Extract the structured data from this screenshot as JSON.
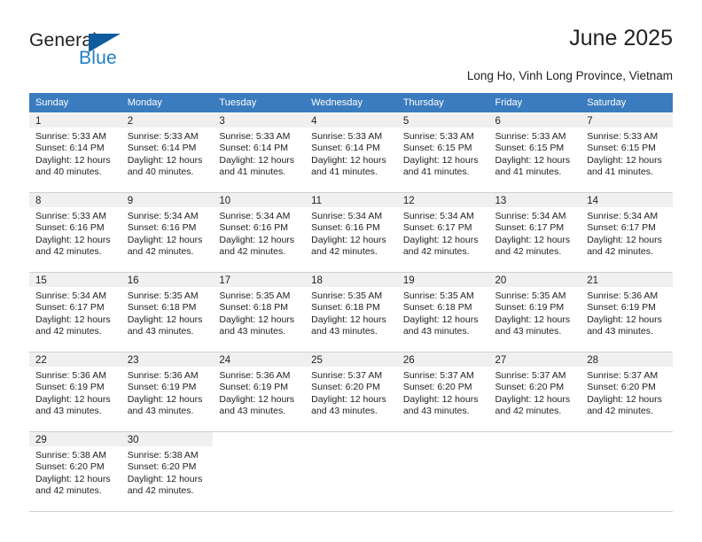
{
  "logo": {
    "text_top": "General",
    "text_bottom": "Blue",
    "triangle_color": "#0d5c9e",
    "blue_color": "#1f7ec2"
  },
  "header": {
    "title": "June 2025",
    "subtitle": "Long Ho, Vinh Long Province, Vietnam"
  },
  "theme": {
    "header_bg": "#3a7cbe",
    "header_text": "#ffffff",
    "daynum_bg": "#f0f0f0",
    "grid_line": "#cfcfcf",
    "body_text": "#222222"
  },
  "calendar": {
    "weekday_headers": [
      "Sunday",
      "Monday",
      "Tuesday",
      "Wednesday",
      "Thursday",
      "Friday",
      "Saturday"
    ],
    "weeks": [
      [
        {
          "day": "1",
          "sunrise": "Sunrise: 5:33 AM",
          "sunset": "Sunset: 6:14 PM",
          "daylight_line1": "Daylight: 12 hours",
          "daylight_line2": "and 40 minutes."
        },
        {
          "day": "2",
          "sunrise": "Sunrise: 5:33 AM",
          "sunset": "Sunset: 6:14 PM",
          "daylight_line1": "Daylight: 12 hours",
          "daylight_line2": "and 40 minutes."
        },
        {
          "day": "3",
          "sunrise": "Sunrise: 5:33 AM",
          "sunset": "Sunset: 6:14 PM",
          "daylight_line1": "Daylight: 12 hours",
          "daylight_line2": "and 41 minutes."
        },
        {
          "day": "4",
          "sunrise": "Sunrise: 5:33 AM",
          "sunset": "Sunset: 6:14 PM",
          "daylight_line1": "Daylight: 12 hours",
          "daylight_line2": "and 41 minutes."
        },
        {
          "day": "5",
          "sunrise": "Sunrise: 5:33 AM",
          "sunset": "Sunset: 6:15 PM",
          "daylight_line1": "Daylight: 12 hours",
          "daylight_line2": "and 41 minutes."
        },
        {
          "day": "6",
          "sunrise": "Sunrise: 5:33 AM",
          "sunset": "Sunset: 6:15 PM",
          "daylight_line1": "Daylight: 12 hours",
          "daylight_line2": "and 41 minutes."
        },
        {
          "day": "7",
          "sunrise": "Sunrise: 5:33 AM",
          "sunset": "Sunset: 6:15 PM",
          "daylight_line1": "Daylight: 12 hours",
          "daylight_line2": "and 41 minutes."
        }
      ],
      [
        {
          "day": "8",
          "sunrise": "Sunrise: 5:33 AM",
          "sunset": "Sunset: 6:16 PM",
          "daylight_line1": "Daylight: 12 hours",
          "daylight_line2": "and 42 minutes."
        },
        {
          "day": "9",
          "sunrise": "Sunrise: 5:34 AM",
          "sunset": "Sunset: 6:16 PM",
          "daylight_line1": "Daylight: 12 hours",
          "daylight_line2": "and 42 minutes."
        },
        {
          "day": "10",
          "sunrise": "Sunrise: 5:34 AM",
          "sunset": "Sunset: 6:16 PM",
          "daylight_line1": "Daylight: 12 hours",
          "daylight_line2": "and 42 minutes."
        },
        {
          "day": "11",
          "sunrise": "Sunrise: 5:34 AM",
          "sunset": "Sunset: 6:16 PM",
          "daylight_line1": "Daylight: 12 hours",
          "daylight_line2": "and 42 minutes."
        },
        {
          "day": "12",
          "sunrise": "Sunrise: 5:34 AM",
          "sunset": "Sunset: 6:17 PM",
          "daylight_line1": "Daylight: 12 hours",
          "daylight_line2": "and 42 minutes."
        },
        {
          "day": "13",
          "sunrise": "Sunrise: 5:34 AM",
          "sunset": "Sunset: 6:17 PM",
          "daylight_line1": "Daylight: 12 hours",
          "daylight_line2": "and 42 minutes."
        },
        {
          "day": "14",
          "sunrise": "Sunrise: 5:34 AM",
          "sunset": "Sunset: 6:17 PM",
          "daylight_line1": "Daylight: 12 hours",
          "daylight_line2": "and 42 minutes."
        }
      ],
      [
        {
          "day": "15",
          "sunrise": "Sunrise: 5:34 AM",
          "sunset": "Sunset: 6:17 PM",
          "daylight_line1": "Daylight: 12 hours",
          "daylight_line2": "and 42 minutes."
        },
        {
          "day": "16",
          "sunrise": "Sunrise: 5:35 AM",
          "sunset": "Sunset: 6:18 PM",
          "daylight_line1": "Daylight: 12 hours",
          "daylight_line2": "and 43 minutes."
        },
        {
          "day": "17",
          "sunrise": "Sunrise: 5:35 AM",
          "sunset": "Sunset: 6:18 PM",
          "daylight_line1": "Daylight: 12 hours",
          "daylight_line2": "and 43 minutes."
        },
        {
          "day": "18",
          "sunrise": "Sunrise: 5:35 AM",
          "sunset": "Sunset: 6:18 PM",
          "daylight_line1": "Daylight: 12 hours",
          "daylight_line2": "and 43 minutes."
        },
        {
          "day": "19",
          "sunrise": "Sunrise: 5:35 AM",
          "sunset": "Sunset: 6:18 PM",
          "daylight_line1": "Daylight: 12 hours",
          "daylight_line2": "and 43 minutes."
        },
        {
          "day": "20",
          "sunrise": "Sunrise: 5:35 AM",
          "sunset": "Sunset: 6:19 PM",
          "daylight_line1": "Daylight: 12 hours",
          "daylight_line2": "and 43 minutes."
        },
        {
          "day": "21",
          "sunrise": "Sunrise: 5:36 AM",
          "sunset": "Sunset: 6:19 PM",
          "daylight_line1": "Daylight: 12 hours",
          "daylight_line2": "and 43 minutes."
        }
      ],
      [
        {
          "day": "22",
          "sunrise": "Sunrise: 5:36 AM",
          "sunset": "Sunset: 6:19 PM",
          "daylight_line1": "Daylight: 12 hours",
          "daylight_line2": "and 43 minutes."
        },
        {
          "day": "23",
          "sunrise": "Sunrise: 5:36 AM",
          "sunset": "Sunset: 6:19 PM",
          "daylight_line1": "Daylight: 12 hours",
          "daylight_line2": "and 43 minutes."
        },
        {
          "day": "24",
          "sunrise": "Sunrise: 5:36 AM",
          "sunset": "Sunset: 6:19 PM",
          "daylight_line1": "Daylight: 12 hours",
          "daylight_line2": "and 43 minutes."
        },
        {
          "day": "25",
          "sunrise": "Sunrise: 5:37 AM",
          "sunset": "Sunset: 6:20 PM",
          "daylight_line1": "Daylight: 12 hours",
          "daylight_line2": "and 43 minutes."
        },
        {
          "day": "26",
          "sunrise": "Sunrise: 5:37 AM",
          "sunset": "Sunset: 6:20 PM",
          "daylight_line1": "Daylight: 12 hours",
          "daylight_line2": "and 43 minutes."
        },
        {
          "day": "27",
          "sunrise": "Sunrise: 5:37 AM",
          "sunset": "Sunset: 6:20 PM",
          "daylight_line1": "Daylight: 12 hours",
          "daylight_line2": "and 42 minutes."
        },
        {
          "day": "28",
          "sunrise": "Sunrise: 5:37 AM",
          "sunset": "Sunset: 6:20 PM",
          "daylight_line1": "Daylight: 12 hours",
          "daylight_line2": "and 42 minutes."
        }
      ],
      [
        {
          "day": "29",
          "sunrise": "Sunrise: 5:38 AM",
          "sunset": "Sunset: 6:20 PM",
          "daylight_line1": "Daylight: 12 hours",
          "daylight_line2": "and 42 minutes."
        },
        {
          "day": "30",
          "sunrise": "Sunrise: 5:38 AM",
          "sunset": "Sunset: 6:20 PM",
          "daylight_line1": "Daylight: 12 hours",
          "daylight_line2": "and 42 minutes."
        },
        {
          "day": "",
          "sunrise": "",
          "sunset": "",
          "daylight_line1": "",
          "daylight_line2": ""
        },
        {
          "day": "",
          "sunrise": "",
          "sunset": "",
          "daylight_line1": "",
          "daylight_line2": ""
        },
        {
          "day": "",
          "sunrise": "",
          "sunset": "",
          "daylight_line1": "",
          "daylight_line2": ""
        },
        {
          "day": "",
          "sunrise": "",
          "sunset": "",
          "daylight_line1": "",
          "daylight_line2": ""
        },
        {
          "day": "",
          "sunrise": "",
          "sunset": "",
          "daylight_line1": "",
          "daylight_line2": ""
        }
      ]
    ]
  }
}
